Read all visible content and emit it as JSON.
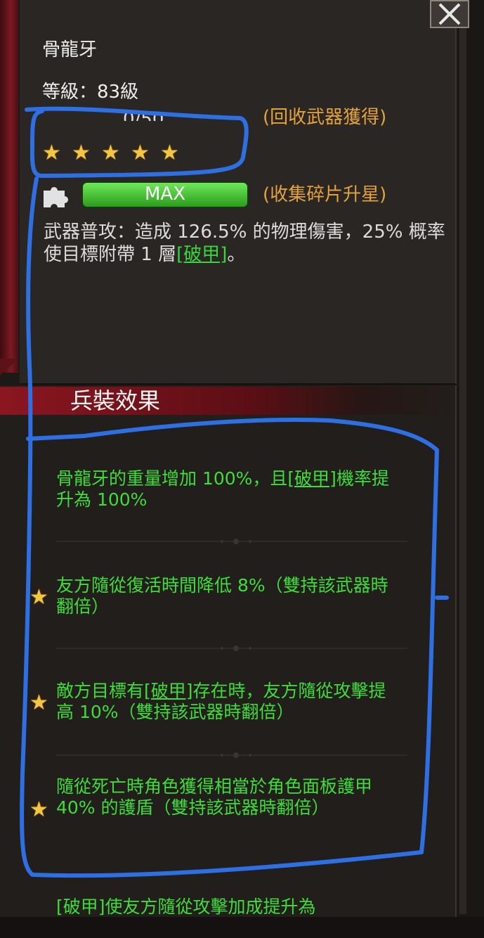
{
  "weapon": {
    "name": "骨龍牙",
    "level": "等級：83級",
    "counter": "0/50",
    "recycle_hint": "(回收武器獲得)",
    "shard_hint": "(收集碎片升星)",
    "stars": 5,
    "progress_label": "MAX",
    "progress_fraction": 1.0,
    "description_pre": "武器普攻：造成 126.5% 的物理傷害，25% 概率使目標附帶 1 層",
    "description_tag": "[破甲]",
    "description_post": "。"
  },
  "effects": {
    "title": "兵裝效果",
    "items": [
      {
        "star": false,
        "pre": "骨龍牙的重量增加 100%，且",
        "tag": "[破甲]",
        "post": "機率提升為 100%"
      },
      {
        "star": true,
        "pre": "友方隨從復活時間降低 8%（雙持該武器時翻倍）",
        "tag": "",
        "post": ""
      },
      {
        "star": true,
        "pre": "敵方目標有",
        "tag": "[破甲]",
        "post": "存在時，友方隨從攻擊提高 10%（雙持該武器時翻倍）"
      },
      {
        "star": true,
        "pre": "隨從死亡時角色獲得相當於角色面板護甲 40% 的護盾（雙持該武器時翻倍）",
        "tag": "",
        "post": ""
      }
    ],
    "partial_next": "[破甲]使友方隨從攻擊加成提升為"
  },
  "colors": {
    "accent_green": "#3fdc3a",
    "orange": "#e4a23a",
    "star": "#f3c542",
    "highlight": "#2f6fe4"
  },
  "icons": {
    "close": "close-icon",
    "star": "star-icon",
    "puzzle": "puzzle-piece-icon"
  }
}
